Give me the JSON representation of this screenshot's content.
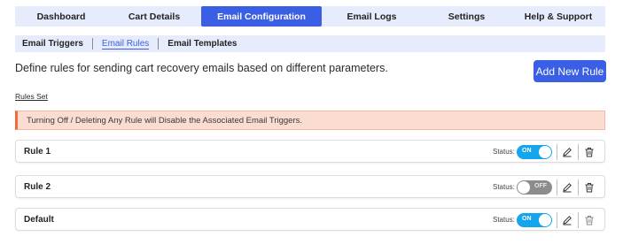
{
  "main_tabs": [
    {
      "label": "Dashboard"
    },
    {
      "label": "Cart Details"
    },
    {
      "label": "Email Configuration",
      "active": true
    },
    {
      "label": "Email Logs"
    },
    {
      "label": "Settings"
    },
    {
      "label": "Help & Support"
    }
  ],
  "sub_tabs": [
    {
      "label": "Email Triggers"
    },
    {
      "label": "Email Rules",
      "active": true
    },
    {
      "label": "Email Templates"
    }
  ],
  "page": {
    "description": "Define rules for sending cart recovery emails based on different parameters.",
    "add_button": "Add New Rule",
    "rules_set_label": "Rules Set",
    "warning": "Turning Off / Deleting Any Rule will Disable the Associated Email Triggers."
  },
  "status_label": "Status:",
  "rules": [
    {
      "name": "Rule 1",
      "toggle": "ON",
      "enabled": true
    },
    {
      "name": "Rule 2",
      "toggle": "OFF",
      "enabled": false
    },
    {
      "name": "Default",
      "toggle": "ON",
      "enabled": true
    }
  ],
  "colors": {
    "accent": "#3a5ee4",
    "toggle_on": "#15a5ec",
    "toggle_off": "#8c8c8c",
    "warning_bg": "#fbdcd0",
    "warning_border": "#f26b3a"
  },
  "icons": {
    "edit": "pencil-icon",
    "delete": "trash-icon"
  }
}
